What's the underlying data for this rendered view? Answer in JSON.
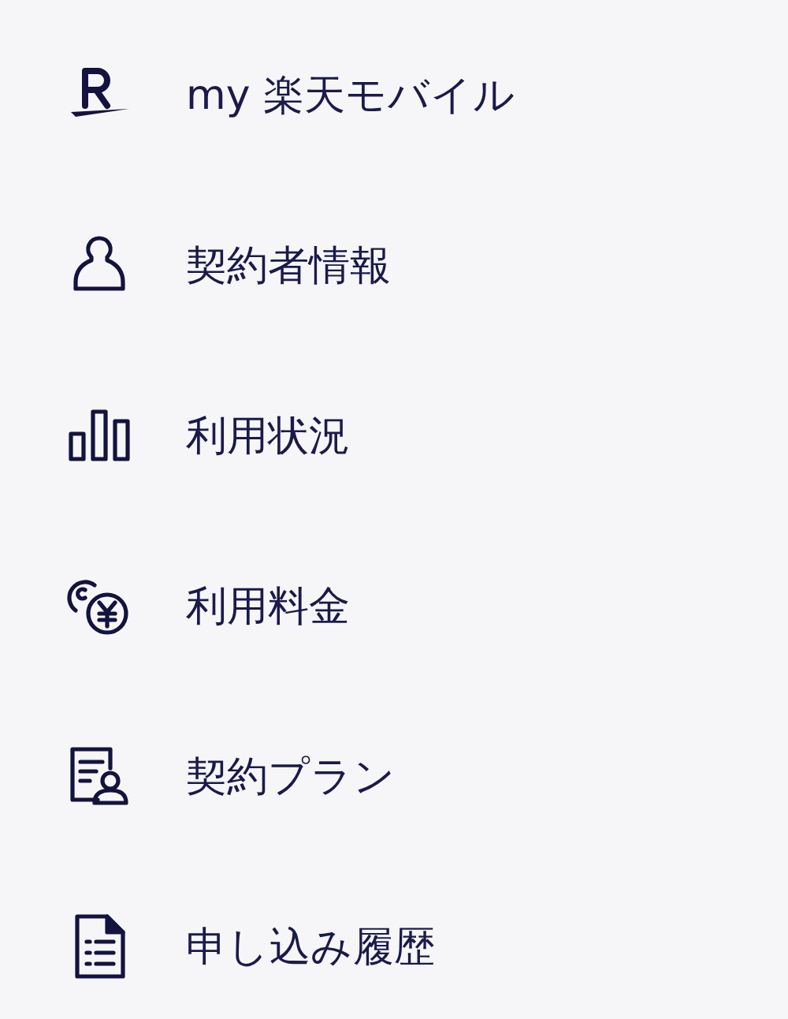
{
  "menu": {
    "items": [
      {
        "label": "my 楽天モバイル"
      },
      {
        "label": "契約者情報"
      },
      {
        "label": "利用状況"
      },
      {
        "label": "利用料金"
      },
      {
        "label": "契約プラン"
      },
      {
        "label": "申し込み履歴"
      }
    ]
  }
}
